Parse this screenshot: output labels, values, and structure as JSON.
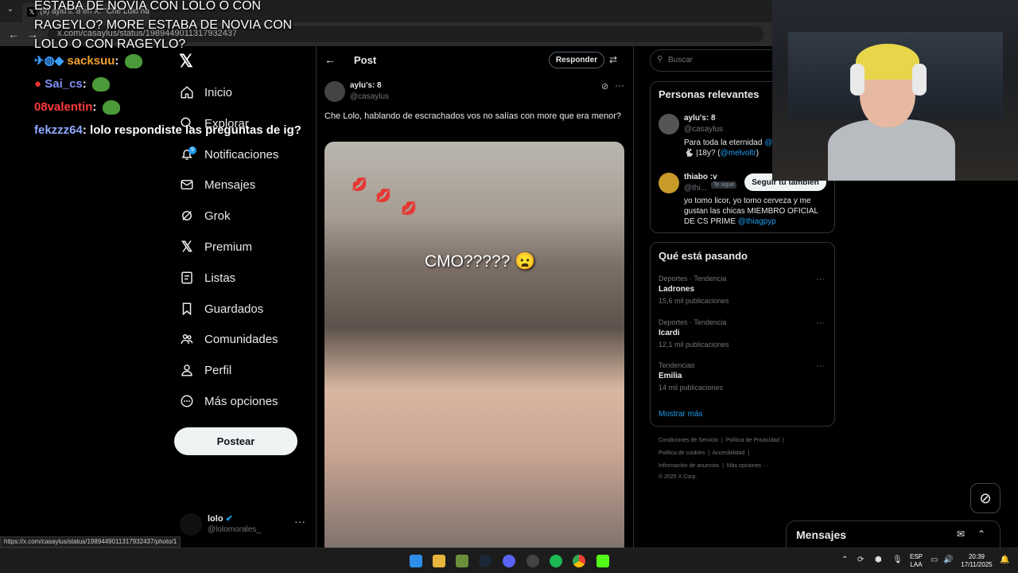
{
  "browser": {
    "tab_title": "(9) aylu's: 8 en X: \"Che Lolo hab",
    "url": "x.com/casaylus/status/1989449011317932437"
  },
  "stream": {
    "overlay_title": "ESTABA DE NOVIA CON LOLO O CON RAGEYLO? MORE ESTABA DE NOVIA CON LOLO O CON RAGEYLO?",
    "chat": [
      {
        "user": "sacksuu",
        "message": "",
        "color": "#f0a030"
      },
      {
        "user": "Sai_cs",
        "message": "",
        "color": "#7e8ff5"
      },
      {
        "user": "08valentin",
        "message": "",
        "color": "#ff3b3b"
      },
      {
        "user": "fekzzz64",
        "message": "lolo respondiste las preguntas de ig?",
        "color": "#8fa8ff"
      }
    ]
  },
  "sidebar": {
    "items": [
      {
        "label": "Inicio",
        "icon": "home-icon"
      },
      {
        "label": "Explorar",
        "icon": "search-icon"
      },
      {
        "label": "Notificaciones",
        "icon": "bell-icon",
        "badge": "9"
      },
      {
        "label": "Mensajes",
        "icon": "mail-icon"
      },
      {
        "label": "Grok",
        "icon": "grok-icon"
      },
      {
        "label": "Premium",
        "icon": "x-icon"
      },
      {
        "label": "Listas",
        "icon": "list-icon"
      },
      {
        "label": "Guardados",
        "icon": "bookmark-icon"
      },
      {
        "label": "Comunidades",
        "icon": "people-icon"
      },
      {
        "label": "Perfil",
        "icon": "person-icon"
      },
      {
        "label": "Más opciones",
        "icon": "more-circle-icon"
      }
    ],
    "post_button": "Postear",
    "account": {
      "name": "lolo",
      "handle": "@lolomorales_"
    }
  },
  "post": {
    "header_title": "Post",
    "reply_label": "Responder",
    "author_name": "aylu's: 8",
    "author_handle": "@casaylus",
    "text": "Che Lolo, hablando de escrachados vos no salías con more que era menor?",
    "image_caption": "CMO????? 😦"
  },
  "right": {
    "search_placeholder": "Buscar",
    "relevant": {
      "title": "Personas relevantes",
      "people": [
        {
          "name": "aylu's: 8",
          "handle": "@casaylus",
          "bio": "Para toda la eternidad",
          "bio_link": "@",
          "bio2": "🐇 |18y? (",
          "bio2_link": "@melvoltr",
          "bio2_end": ")"
        },
        {
          "name": "thiabo :v",
          "handle": "@thi...",
          "chip": "Te sigue",
          "follow_label": "Seguir tú también",
          "bio": "yo tomo licor, yo tomo cerveza y me gustan las chicas MIEMBRO OFICIAL DE CS PRIME",
          "bio_link": "@thiagpyp"
        }
      ]
    },
    "trends": {
      "title": "Qué está pasando",
      "items": [
        {
          "category": "Deportes · Tendencia",
          "name": "Ladrones",
          "count": "15,6 mil publicaciones"
        },
        {
          "category": "Deportes · Tendencia",
          "name": "Icardi",
          "count": "12,1 mil publicaciones"
        },
        {
          "category": "Tendencias",
          "name": "Emilia",
          "count": "14 mil publicaciones"
        }
      ],
      "show_more": "Mostrar más"
    },
    "footer": {
      "line1a": "Condiciones de Servicio",
      "line1b": "Política de Privacidad",
      "line2a": "Política de cookies",
      "line2b": "Accesibilidad",
      "line3a": "Información de anuncios",
      "line3b": "Más opciones ···",
      "line4": "© 2025 X Corp."
    }
  },
  "dm_dock": {
    "title": "Mensajes"
  },
  "status_bar_url": "https://x.com/casaylus/status/1989449011317932437/photo/1",
  "taskbar": {
    "lang_top": "ESP",
    "lang_bottom": "LAA",
    "time": "20:39",
    "date": "17/11/2025"
  },
  "colors": {
    "accent": "#1d9bf0",
    "background": "#000000",
    "border": "#2f3336"
  }
}
